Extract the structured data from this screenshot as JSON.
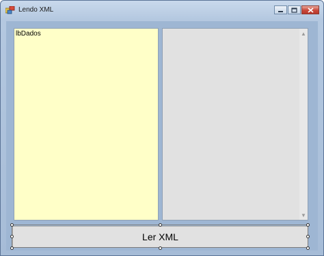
{
  "window": {
    "title": "Lendo XML",
    "controls": {
      "minimize_icon": "minimize-icon",
      "maximize_icon": "maximize-icon",
      "close_icon": "close-icon"
    }
  },
  "left_listbox": {
    "label": "lbDados",
    "background_color": "#ffffc8"
  },
  "right_listbox": {
    "background_color": "#e1e1e1",
    "scroll_up_icon": "chevron-up-icon",
    "scroll_down_icon": "chevron-down-icon"
  },
  "read_button": {
    "label": "Ler XML"
  }
}
